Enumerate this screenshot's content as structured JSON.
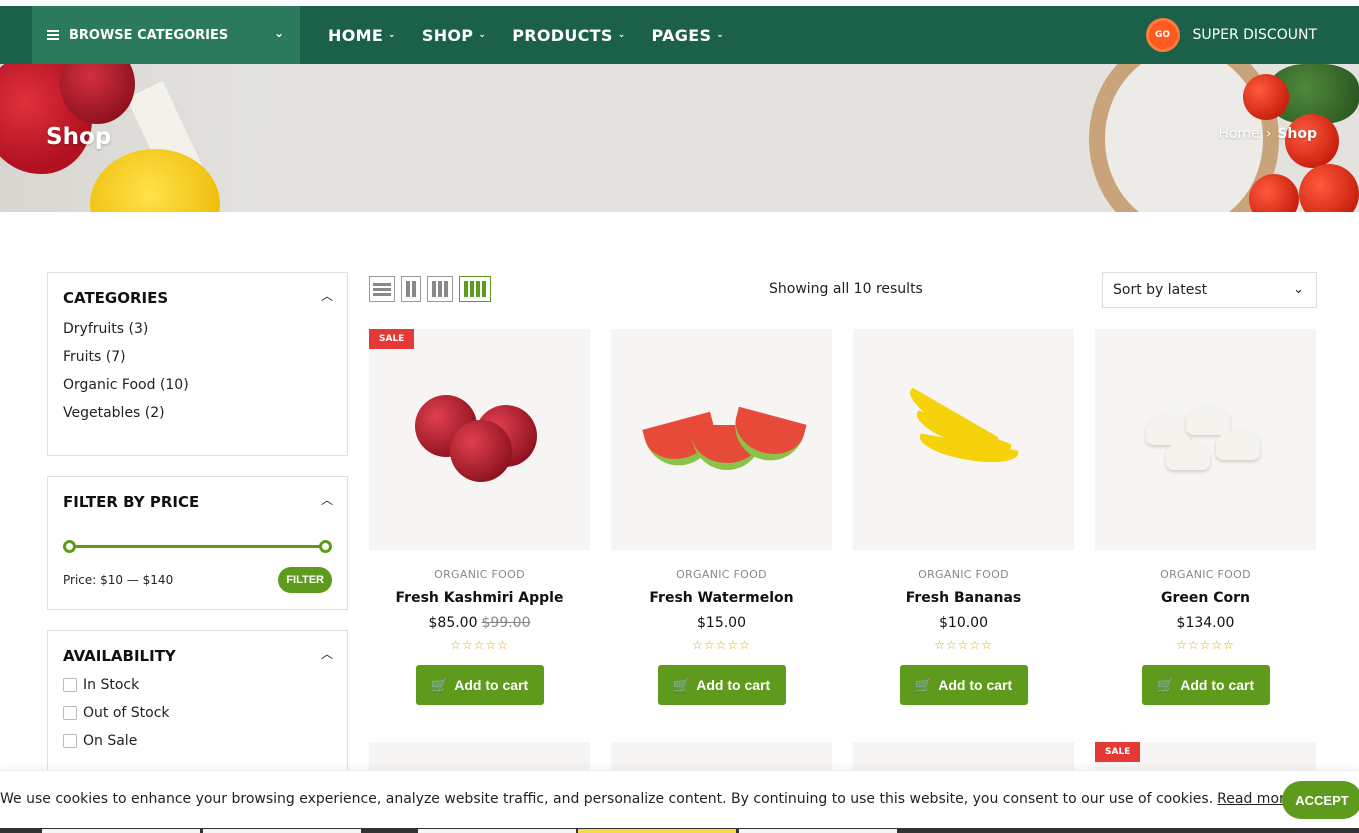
{
  "nav": {
    "browse_label": "BROWSE CATEGORIES",
    "menu": [
      {
        "label": "HOME"
      },
      {
        "label": "SHOP"
      },
      {
        "label": "PRODUCTS"
      },
      {
        "label": "PAGES"
      }
    ],
    "discount_badge": "GO",
    "discount_label": "SUPER DISCOUNT"
  },
  "hero": {
    "title": "Shop",
    "breadcrumb_home": "Home",
    "breadcrumb_sep": "›",
    "breadcrumb_current": "Shop"
  },
  "sidebar": {
    "categories_title": "CATEGORIES",
    "categories": [
      {
        "label": "Dryfruits (3)"
      },
      {
        "label": "Fruits (7)"
      },
      {
        "label": "Organic Food (10)"
      },
      {
        "label": "Vegetables (2)"
      }
    ],
    "price_title": "FILTER BY PRICE",
    "price_range": {
      "min": 10,
      "max": 140
    },
    "price_label": "Price: $10 — $140",
    "filter_button": "FILTER",
    "availability_title": "AVAILABILITY",
    "availability": [
      {
        "label": "In Stock"
      },
      {
        "label": "Out of Stock"
      },
      {
        "label": "On Sale"
      }
    ]
  },
  "toolbar": {
    "results": "Showing all 10 results",
    "sort_selected": "Sort by latest",
    "active_view": "4-column"
  },
  "products": [
    {
      "category": "ORGANIC FOOD",
      "name": "Fresh Kashmiri Apple",
      "price": "$85.00",
      "old_price": "$99.00",
      "sale_badge": "SALE",
      "rating": 0,
      "button": "Add to cart"
    },
    {
      "category": "ORGANIC FOOD",
      "name": "Fresh Watermelon",
      "price": "$15.00",
      "old_price": "",
      "sale_badge": "",
      "rating": 0,
      "button": "Add to cart"
    },
    {
      "category": "ORGANIC FOOD",
      "name": "Fresh Bananas",
      "price": "$10.00",
      "old_price": "",
      "sale_badge": "",
      "rating": 0,
      "button": "Add to cart"
    },
    {
      "category": "ORGANIC FOOD",
      "name": "Green Corn",
      "price": "$134.00",
      "old_price": "",
      "sale_badge": "",
      "rating": 0,
      "button": "Add to cart"
    }
  ],
  "second_row_sale_badge": "SALE",
  "cookie": {
    "text": "We use cookies to enhance your browsing experience, analyze website traffic, and personalize content. By continuing to use this website, you consent to our use of cookies.",
    "link": "Read more",
    "accept": "ACCEPT"
  },
  "colors": {
    "nav_bg": "#1b6049",
    "browse_bg": "#2a7a5b",
    "accent_green": "#5e9a1c",
    "sale_red": "#e53935",
    "star_gold": "#e0a800"
  }
}
